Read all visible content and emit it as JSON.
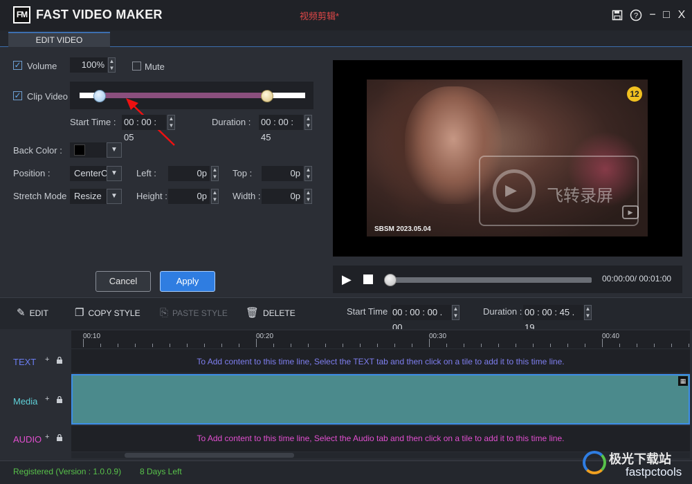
{
  "app": {
    "logo_text": "FM",
    "title": "FAST VIDEO MAKER",
    "project_name": "视频剪辑*"
  },
  "window_controls": {
    "save_icon": "💾",
    "help_icon": "?",
    "minimize_icon": "−",
    "maximize_icon": "□",
    "close_icon": "X"
  },
  "tabs": [
    {
      "label": "EDIT VIDEO",
      "active": true
    }
  ],
  "edit_panel": {
    "volume": {
      "label": "Volume",
      "checked": true,
      "value": "100%"
    },
    "mute": {
      "label": "Mute",
      "checked": false
    },
    "clip_video": {
      "label": "Clip Video",
      "checked": true,
      "start_fraction": 0.09,
      "end_fraction": 0.83
    },
    "start_time": {
      "label": "Start Time :",
      "value": "00 : 00 : 05"
    },
    "duration": {
      "label": "Duration :",
      "value": "00 : 00 : 45"
    },
    "back_color": {
      "label": "Back Color :",
      "value": "#000000"
    },
    "position": {
      "label": "Position :",
      "value": "CenterCe"
    },
    "left": {
      "label": "Left :",
      "value": "0p"
    },
    "top": {
      "label": "Top :",
      "value": "0p"
    },
    "stretch_mode": {
      "label": "Stretch Mode",
      "value": "Resize"
    },
    "height": {
      "label": "Height :",
      "value": "0p"
    },
    "width": {
      "label": "Width :",
      "value": "0p"
    },
    "cancel_label": "Cancel",
    "apply_label": "Apply"
  },
  "preview": {
    "age_badge": "12",
    "caption": "SBSM 2023.05.04",
    "watermark_text": "飞转录屏",
    "play_icon": "▶",
    "time_display": "00:00:00/  00:01:00",
    "progress": 0.0
  },
  "timeline_toolbar": {
    "edit_label": "EDIT",
    "copy_style_label": "COPY STYLE",
    "paste_style_label": "PASTE STYLE",
    "delete_label": "DELETE",
    "start_time_label": "Start Time :",
    "start_time_value": "00 : 00 : 00 . 00",
    "duration_label": "Duration :",
    "duration_value": "00 : 00 : 45 . 19"
  },
  "timeline": {
    "ruler_labels": [
      "00:10",
      "00:20",
      "00:30",
      "00:40"
    ],
    "tracks": [
      {
        "name": "TEXT",
        "color": "#6a7cf0",
        "hint": "To Add content to this time line, Select the TEXT tab and then click on a tile to add it to this time line."
      },
      {
        "name": "Media",
        "color": "#5fd0d8",
        "hint": ""
      },
      {
        "name": "AUDIO",
        "color": "#e24fd0",
        "hint": "To Add content to this time line, Select the Audio tab and then click on a tile to add it to this time line."
      }
    ],
    "add_icon": "+",
    "lock_icon": "🔒"
  },
  "status": {
    "registered": "Registered (Version : 1.0.0.9)",
    "days_left": "8 Days Left",
    "brand_cn": "极光下载站",
    "brand_en": "fastpctools"
  },
  "colors": {
    "accent": "#2f7de1",
    "status_green": "#58c24a",
    "clip_range": "#8a4f7d",
    "media_track": "#4b8a8c"
  }
}
